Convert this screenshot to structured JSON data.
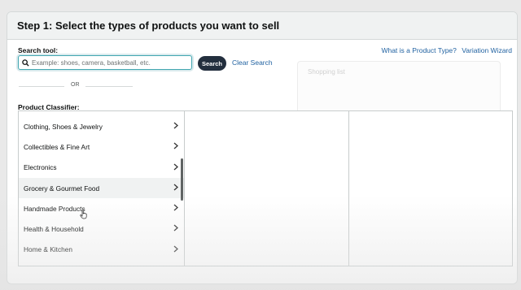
{
  "header": {
    "title": "Step 1: Select the types of products you want to sell"
  },
  "search": {
    "label": "Search tool:",
    "placeholder": "Example: shoes, camera, basketball, etc.",
    "button_label": "Search",
    "clear_label": "Clear Search"
  },
  "links": {
    "product_type": "What is a Product Type?",
    "variation_wizard": "Variation Wizard"
  },
  "divider": {
    "or_text": "OR"
  },
  "background_panel": {
    "text": "Shopping list"
  },
  "classifier": {
    "label": "Product Classifier:",
    "items": [
      {
        "label": "Clothing, Shoes & Jewelry"
      },
      {
        "label": "Collectibles & Fine Art"
      },
      {
        "label": "Electronics"
      },
      {
        "label": "Grocery & Gourmet Food"
      },
      {
        "label": "Handmade Products"
      },
      {
        "label": "Health & Household"
      },
      {
        "label": "Home & Kitchen"
      }
    ]
  },
  "colors": {
    "link": "#2162a1",
    "button": "#232f3e",
    "input_focus": "#41a6b0",
    "header_bg": "#f0f2f2"
  },
  "icons": [
    "search-icon",
    "chevron-right-icon",
    "hand-pointer-cursor-icon"
  ]
}
